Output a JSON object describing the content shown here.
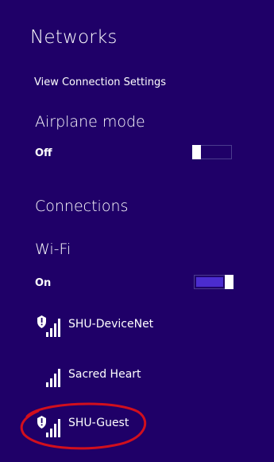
{
  "panel": {
    "title": "Networks",
    "view_settings_link": "View Connection Settings"
  },
  "airplane_mode": {
    "label": "Airplane mode",
    "state_label": "Off",
    "on": false
  },
  "connections": {
    "heading": "Connections"
  },
  "wifi": {
    "label": "Wi-Fi",
    "state_label": "On",
    "on": true
  },
  "networks": [
    {
      "name": "SHU-DeviceNet",
      "secured_icon": "shield-warning-icon",
      "signal_icon": "wifi-signal-icon"
    },
    {
      "name": "Sacred Heart",
      "secured_icon": "",
      "signal_icon": "wifi-signal-icon"
    },
    {
      "name": "SHU-Guest",
      "secured_icon": "shield-warning-icon",
      "signal_icon": "wifi-signal-icon"
    }
  ],
  "colors": {
    "background": "#1f0068",
    "toggle_accent": "#4b2ccf",
    "annotation": "#d10f1d"
  }
}
